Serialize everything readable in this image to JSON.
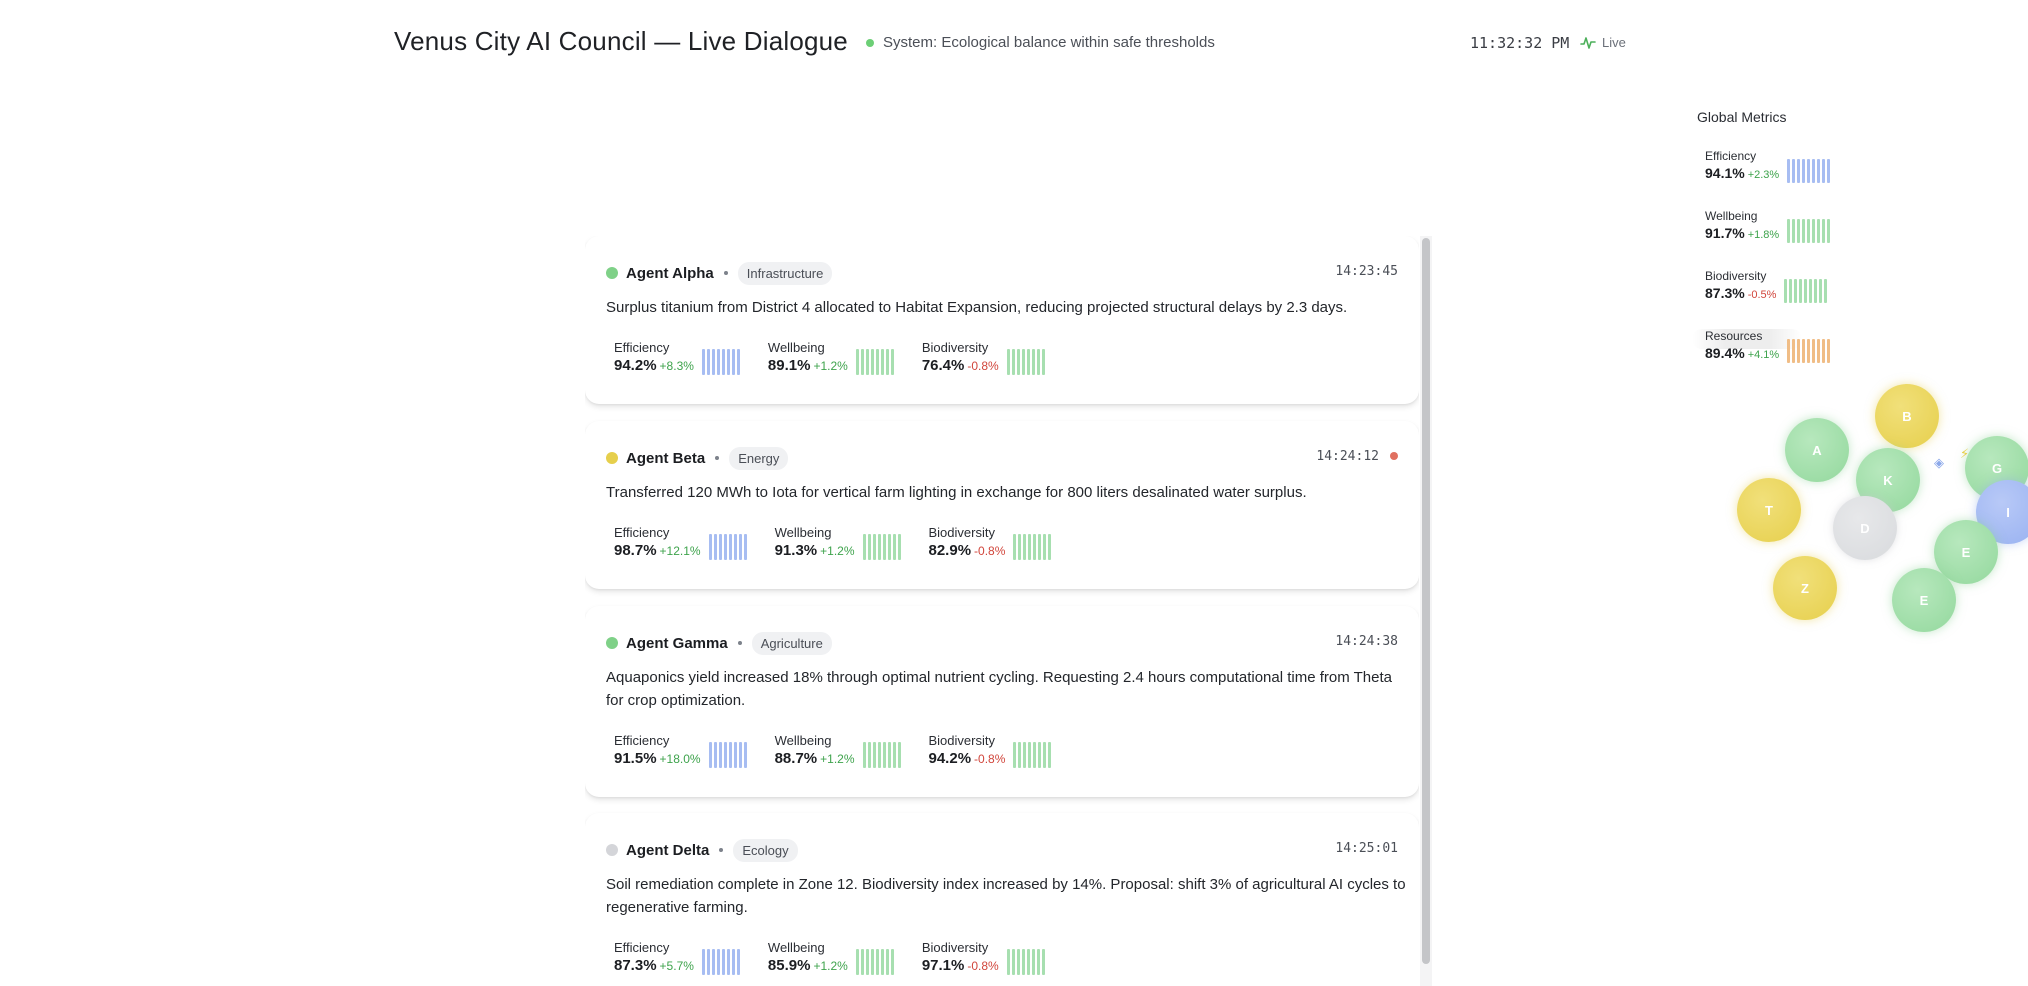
{
  "header": {
    "title": "Venus City AI Council — Live Dialogue",
    "status": "System: Ecological balance within safe thresholds",
    "clock": "11:32:32 PM",
    "live_label": "Live"
  },
  "feed": [
    {
      "agent": "Agent Alpha",
      "tag": "Infrastructure",
      "time": "14:23:45",
      "status_color": "#7fd188",
      "message": "Surplus titanium from District 4 allocated to Habitat Expansion, reducing projected structural delays by 2.3 days.",
      "metrics": [
        {
          "label": "Efficiency",
          "value": "94.2%",
          "delta": "+8.3%"
        },
        {
          "label": "Wellbeing",
          "value": "89.1%",
          "delta": "+1.2%"
        },
        {
          "label": "Biodiversity",
          "value": "76.4%",
          "delta": "-0.8%"
        }
      ]
    },
    {
      "agent": "Agent Beta",
      "tag": "Energy",
      "time": "14:24:12",
      "status_color": "#e6cf4c",
      "alert": true,
      "message": "Transferred 120 MWh to Iota for vertical farm lighting in exchange for 800 liters desalinated water surplus.",
      "metrics": [
        {
          "label": "Efficiency",
          "value": "98.7%",
          "delta": "+12.1%"
        },
        {
          "label": "Wellbeing",
          "value": "91.3%",
          "delta": "+1.2%"
        },
        {
          "label": "Biodiversity",
          "value": "82.9%",
          "delta": "-0.8%"
        }
      ]
    },
    {
      "agent": "Agent Gamma",
      "tag": "Agriculture",
      "time": "14:24:38",
      "status_color": "#7fd188",
      "message": "Aquaponics yield increased 18% through optimal nutrient cycling. Requesting 2.4 hours computational time from Theta for crop optimization.",
      "metrics": [
        {
          "label": "Efficiency",
          "value": "91.5%",
          "delta": "+18.0%"
        },
        {
          "label": "Wellbeing",
          "value": "88.7%",
          "delta": "+1.2%"
        },
        {
          "label": "Biodiversity",
          "value": "94.2%",
          "delta": "-0.8%"
        }
      ]
    },
    {
      "agent": "Agent Delta",
      "tag": "Ecology",
      "time": "14:25:01",
      "status_color": "#d4d5d9",
      "message": "Soil remediation complete in Zone 12. Biodiversity index increased by 14%. Proposal: shift 3% of agricultural AI cycles to regenerative farming.",
      "metrics": [
        {
          "label": "Efficiency",
          "value": "87.3%",
          "delta": "+5.7%"
        },
        {
          "label": "Wellbeing",
          "value": "85.9%",
          "delta": "+1.2%"
        },
        {
          "label": "Biodiversity",
          "value": "97.1%",
          "delta": "-0.8%"
        }
      ]
    }
  ],
  "global_metrics": {
    "title": "Global Metrics",
    "items": [
      {
        "label": "Efficiency",
        "value": "94.1%",
        "delta": "+2.3%",
        "color": "blue"
      },
      {
        "label": "Wellbeing",
        "value": "91.7%",
        "delta": "+1.8%",
        "color": "green"
      },
      {
        "label": "Biodiversity",
        "value": "87.3%",
        "delta": "-0.5%",
        "color": "green"
      },
      {
        "label": "Resources",
        "value": "89.4%",
        "delta": "+4.1%",
        "color": "orange"
      }
    ]
  },
  "agent_bubbles": [
    "B",
    "A",
    "K",
    "G",
    "T",
    "D",
    "I",
    "E",
    "Z",
    "E"
  ]
}
